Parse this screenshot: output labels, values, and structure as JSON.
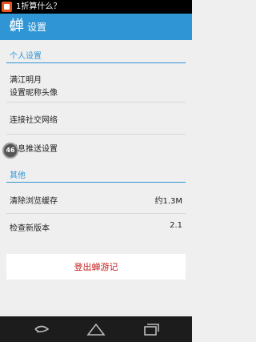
{
  "statusbar": {
    "notification": "1折算什么？"
  },
  "appbar": {
    "back_glyph": "〈",
    "logo": "蝉",
    "title": "设置"
  },
  "sections": {
    "personal": "个人设置",
    "other": "其他"
  },
  "items": {
    "nickname": "满江明月",
    "profile": "设置昵称头像",
    "social": "连接社交网络",
    "push": "消息推送设置",
    "cache_label": "清除浏览缓存",
    "cache_value": "约1.3M",
    "update_label": "检查新版本",
    "update_value": "2.1"
  },
  "badge": "46",
  "logout": "登出蝉游记",
  "colors": {
    "accent": "#2f95d4",
    "logout_text": "#c71c1c"
  },
  "navbar": {
    "icons": [
      "back-icon",
      "home-icon",
      "recent-apps-icon"
    ]
  }
}
